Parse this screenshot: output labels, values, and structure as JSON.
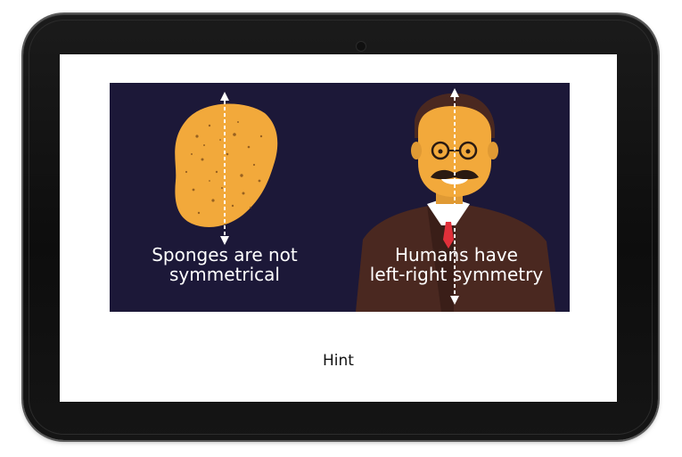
{
  "illustration": {
    "left_caption": {
      "line1": "Sponges are not",
      "line2": "symmetrical"
    },
    "right_caption": {
      "line1": "Humans have",
      "line2": "left-right symmetry"
    }
  },
  "hint": {
    "label": "Hint"
  },
  "colors": {
    "panel_background": "#1c1838",
    "sponge": "#f2a93b",
    "skin": "#f2a93b",
    "suit": "#4a2820",
    "tie": "#e0303a",
    "caption_text": "#ffffff",
    "bezel": "#111111"
  }
}
